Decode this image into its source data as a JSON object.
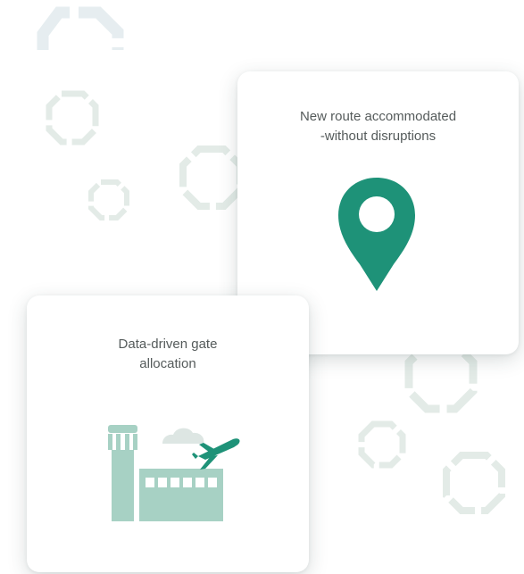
{
  "cards": {
    "route": {
      "line1": "New route accommodated",
      "line2": "-without disruptions",
      "icon": "location-pin-icon"
    },
    "gate": {
      "line1": "Data-driven gate",
      "line2": "allocation",
      "icon": "airport-tower-icon"
    }
  },
  "colors": {
    "pin": "#1e9278",
    "plane": "#1e9278",
    "building": "#a7d1c4",
    "cloud": "#dde6e3",
    "decor_octagon": "#e3ebe7",
    "card_text": "#555b5b"
  }
}
